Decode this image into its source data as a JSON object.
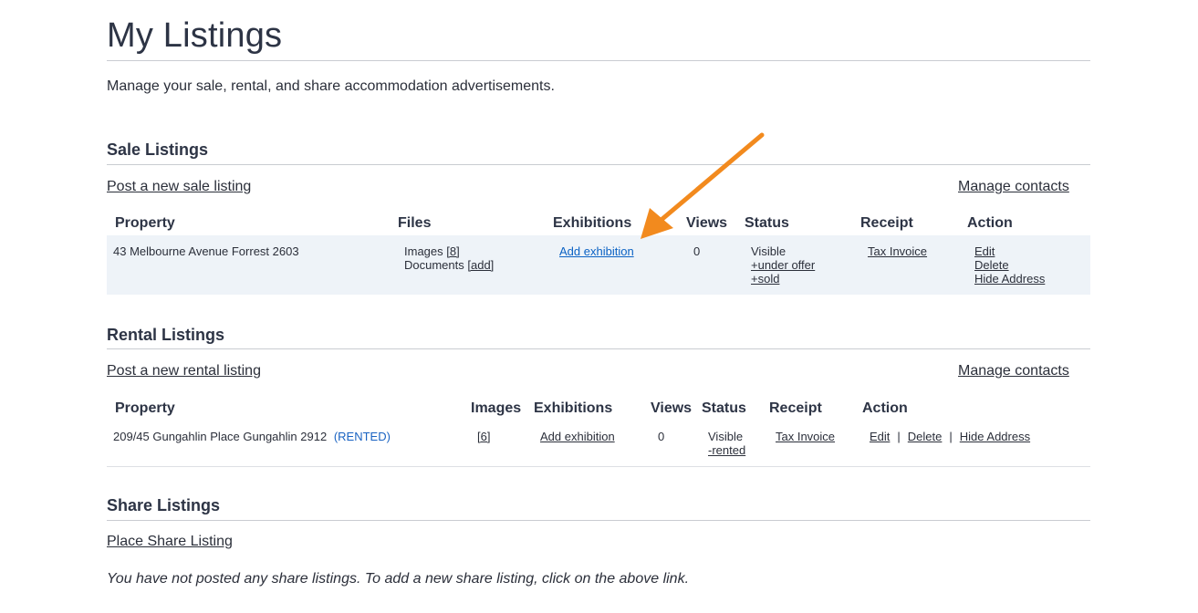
{
  "page": {
    "title": "My Listings",
    "intro": "Manage your sale, rental, and share accommodation advertisements."
  },
  "sale": {
    "heading": "Sale Listings",
    "post_link": "Post a new sale listing",
    "manage_contacts": "Manage contacts",
    "columns": [
      "Property",
      "Files",
      "Exhibitions",
      "Views",
      "Status",
      "Receipt",
      "Action"
    ],
    "row": {
      "property": "43 Melbourne Avenue Forrest 2603",
      "images_label": "Images",
      "images_count": "[8]",
      "documents_label": "Documents",
      "documents_add": "[add]",
      "exhibition": "Add exhibition",
      "views": "0",
      "status": "Visible",
      "status_under_offer": "+under offer",
      "status_sold": "+sold",
      "receipt": "Tax Invoice",
      "action_edit": "Edit",
      "action_delete": "Delete",
      "action_hide": "Hide Address"
    }
  },
  "rental": {
    "heading": "Rental Listings",
    "post_link": "Post a new rental listing",
    "manage_contacts": "Manage contacts",
    "columns": [
      "Property",
      "Images",
      "Exhibitions",
      "Views",
      "Status",
      "Receipt",
      "Action"
    ],
    "row": {
      "property": "209/45 Gungahlin Place Gungahlin 2912",
      "rented_badge": "(RENTED)",
      "images": "[6]",
      "exhibition": "Add exhibition",
      "views": "0",
      "status": "Visible",
      "status_rented": "-rented",
      "receipt": "Tax Invoice",
      "action_edit": "Edit",
      "action_delete": "Delete",
      "action_hide": "Hide Address",
      "separator": "|"
    }
  },
  "share": {
    "heading": "Share Listings",
    "place_link": "Place Share Listing",
    "empty_message": "You have not posted any share listings. To add a new share listing, click on the above link."
  },
  "colors": {
    "accent_link": "#0b62c4",
    "annotation_arrow": "#f28a1e",
    "row_highlight": "#eef3f8"
  }
}
